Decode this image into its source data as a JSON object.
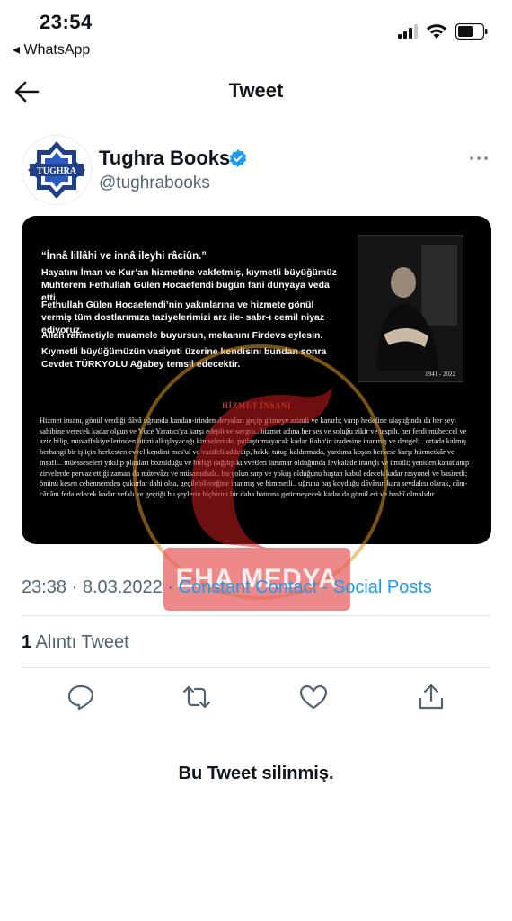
{
  "status_bar": {
    "time": "23:54",
    "back_app": "◂ WhatsApp"
  },
  "header": {
    "title": "Tweet"
  },
  "author": {
    "name": "Tughra Books",
    "handle": "@tughrabooks",
    "avatar_text": "TUGHRA"
  },
  "media": {
    "quote": "“İnnâ lillâhi ve innâ ileyhi râciûn.”",
    "p1": "Hayatını İman ve Kur’an hizmetine vakfetmiş, kıymetli büyüğümüz Muhterem Fethullah Gülen Hocaefendi bugün fani dünyaya veda etti.",
    "p2": "Fethullah Gülen Hocaefendi’nin yakınlarına ve hizmete gönül vermiş tüm dostlarımıza taziyelerimizi arz ile- sabr-ı cemil niyaz ediyoruz.",
    "p3": "Allah rahmetiyle muamele buyursun, mekanını Firdevs eylesin.",
    "p4": "Kıymetli büyüğümüzün vasiyeti üzerine kendisini bundan sonra Cevdet TÜRKYOLU Ağabey temsil edecektir.",
    "years": "1941 - 2022",
    "heading": "HİZMET İNSANI",
    "body": "Hizmet insanı, gönül verdiği dâvâ uğrunda kandan-irinden deryaları geçip gitmeye azimli ve kararlı; varıp hedefine ulaştığında da her şeyi sahibine verecek kadar olgun ve Yüce Yaratıcı'ya karşı edepli ve saygılı.. hizmet adına her ses ve soluğu zikir ve tespih, her ferdi mübeccel ve aziz bilip, muvaffakiyetlerinden ötürü alkışlayacağı kimseleri de, putlaştırmayacak kadar Rabb'in iradesine inanmış ve dengeli.. ortada kalmış herhangi bir iş için herkesten evvel kendini mes'ul ve vazifeli addedip, hakkı tutup kaldırmada, yardıma koşan herkese karşı hürmetkâr ve insaflı.. müesseseleri yıkılıp planları bozulduğu ve birliği dağılıp kuvvetleri târumâr olduğunda fevkalâde inançlı ve ümitli; yeniden kanatlanıp zirvelerde pervaz ettiği zaman da mütevâzı ve müsamahalı.. bu yolun sarp ve yokuş olduğunu baştan kabul edecek kadar rasyonel ve basiretli; önünü kesen cehennemden çukurlar dahi olsa, geçilebileceğine inanmış ve himmetli.. uğruna baş koyduğu dâvânın kara sevdalısı olarak, cânı-cânânı feda edecek kadar vefalı ve geçtiği bu şeylerin hiçbirini bir daha hatırına getirmeyecek kadar da gönül eri ve hasbî olmalıdır"
  },
  "meta": {
    "datetime": "23:38 · 8.03.2022 · ",
    "source": "Constant Contact - Social Posts"
  },
  "quotes": {
    "count": "1",
    "label": " Alıntı Tweet"
  },
  "watermark": {
    "text": "EHA MEDYA"
  },
  "deleted_notice": "Bu Tweet silinmiş.",
  "colors": {
    "verified": "#1d9bf0",
    "link": "#1d9bf0",
    "muted": "#536471",
    "watermark": "#e75c5c"
  }
}
